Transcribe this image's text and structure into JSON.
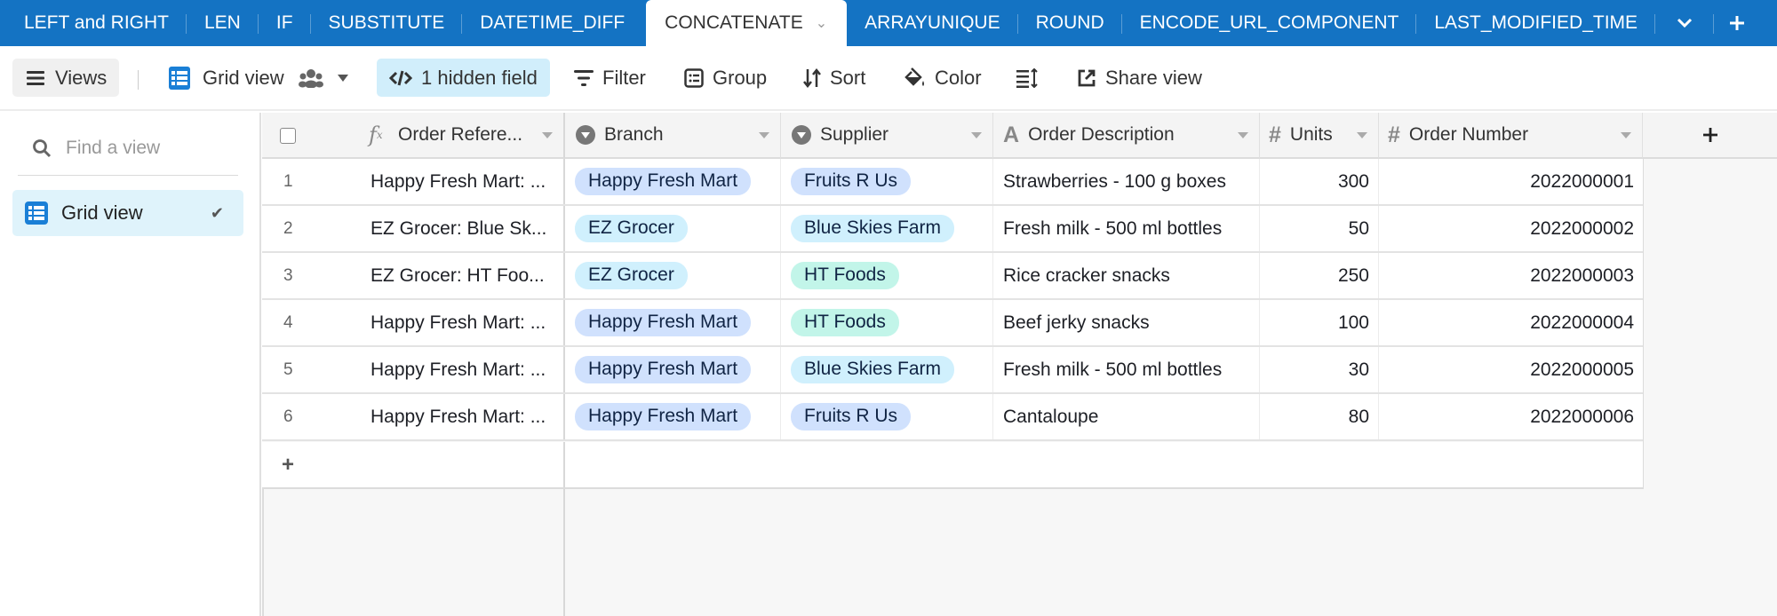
{
  "tabs": [
    {
      "label": "LEFT and RIGHT",
      "active": false
    },
    {
      "label": "LEN",
      "active": false
    },
    {
      "label": "IF",
      "active": false
    },
    {
      "label": "SUBSTITUTE",
      "active": false
    },
    {
      "label": "DATETIME_DIFF",
      "active": false
    },
    {
      "label": "CONCATENATE",
      "active": true
    },
    {
      "label": "ARRAYUNIQUE",
      "active": false
    },
    {
      "label": "ROUND",
      "active": false
    },
    {
      "label": "ENCODE_URL_COMPONENT",
      "active": false
    },
    {
      "label": "LAST_MODIFIED_TIME",
      "active": false
    }
  ],
  "tab_controls": {
    "more_icon": "chevron-down-icon",
    "add_icon": "plus-icon"
  },
  "toolbar": {
    "views_label": "Views",
    "grid_view_label": "Grid view",
    "hidden_fields_label": "1 hidden field",
    "filter_label": "Filter",
    "group_label": "Group",
    "sort_label": "Sort",
    "color_label": "Color",
    "share_label": "Share view"
  },
  "sidebar": {
    "search_placeholder": "Find a view",
    "views": [
      {
        "label": "Grid view",
        "selected": true
      }
    ]
  },
  "colors": {
    "tabbar": "#1473c3",
    "hidden_field_bg": "#d1eefb",
    "pill_blue": "#d0e1fd",
    "pill_cyan": "#d0f0fd",
    "pill_teal": "#c2f5e9"
  },
  "table": {
    "columns": [
      {
        "name": "Order Reference",
        "display": "Order Refere...",
        "type": "formula"
      },
      {
        "name": "Branch",
        "display": "Branch",
        "type": "single-select"
      },
      {
        "name": "Supplier",
        "display": "Supplier",
        "type": "single-select"
      },
      {
        "name": "Order Description",
        "display": "Order Description",
        "type": "text"
      },
      {
        "name": "Units",
        "display": "Units",
        "type": "number"
      },
      {
        "name": "Order Number",
        "display": "Order Number",
        "type": "number"
      }
    ],
    "rows": [
      {
        "num": "1",
        "ref": "Happy Fresh Mart: ...",
        "branch": "Happy Fresh Mart",
        "supplier": "Fruits R Us",
        "desc": "Strawberries - 100 g boxes",
        "units": "300",
        "order": "2022000001"
      },
      {
        "num": "2",
        "ref": "EZ Grocer: Blue Sk...",
        "branch": "EZ Grocer",
        "supplier": "Blue Skies Farm",
        "desc": "Fresh milk - 500 ml bottles",
        "units": "50",
        "order": "2022000002"
      },
      {
        "num": "3",
        "ref": "EZ Grocer: HT Foo...",
        "branch": "EZ Grocer",
        "supplier": "HT Foods",
        "desc": "Rice cracker snacks",
        "units": "250",
        "order": "2022000003"
      },
      {
        "num": "4",
        "ref": "Happy Fresh Mart: ...",
        "branch": "Happy Fresh Mart",
        "supplier": "HT Foods",
        "desc": "Beef jerky snacks",
        "units": "100",
        "order": "2022000004"
      },
      {
        "num": "5",
        "ref": "Happy Fresh Mart: ...",
        "branch": "Happy Fresh Mart",
        "supplier": "Blue Skies Farm",
        "desc": "Fresh milk - 500 ml bottles",
        "units": "30",
        "order": "2022000005"
      },
      {
        "num": "6",
        "ref": "Happy Fresh Mart: ...",
        "branch": "Happy Fresh Mart",
        "supplier": "Fruits R Us",
        "desc": "Cantaloupe",
        "units": "80",
        "order": "2022000006"
      }
    ],
    "add_row_label": "+",
    "add_column_label": "+"
  }
}
